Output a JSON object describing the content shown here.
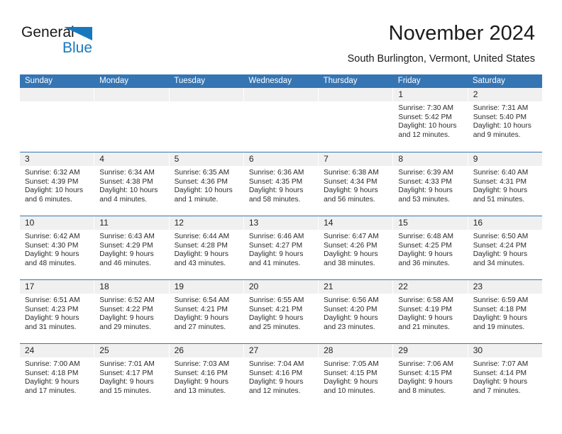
{
  "brand": {
    "name_part1": "General",
    "name_part2": "Blue",
    "accent_color": "#1878be",
    "logo_icon": "triangle-flag-icon"
  },
  "header": {
    "title": "November 2024",
    "subtitle": "South Burlington, Vermont, United States"
  },
  "colors": {
    "header_blue": "#3575b4",
    "day_band_gray": "#f0f0f0",
    "text": "#2b2b2b"
  },
  "weekdays": [
    "Sunday",
    "Monday",
    "Tuesday",
    "Wednesday",
    "Thursday",
    "Friday",
    "Saturday"
  ],
  "weeks": [
    [
      {
        "day": "",
        "lines": []
      },
      {
        "day": "",
        "lines": []
      },
      {
        "day": "",
        "lines": []
      },
      {
        "day": "",
        "lines": []
      },
      {
        "day": "",
        "lines": []
      },
      {
        "day": "1",
        "lines": [
          "Sunrise: 7:30 AM",
          "Sunset: 5:42 PM",
          "Daylight: 10 hours",
          "and 12 minutes."
        ]
      },
      {
        "day": "2",
        "lines": [
          "Sunrise: 7:31 AM",
          "Sunset: 5:40 PM",
          "Daylight: 10 hours",
          "and 9 minutes."
        ]
      }
    ],
    [
      {
        "day": "3",
        "lines": [
          "Sunrise: 6:32 AM",
          "Sunset: 4:39 PM",
          "Daylight: 10 hours",
          "and 6 minutes."
        ]
      },
      {
        "day": "4",
        "lines": [
          "Sunrise: 6:34 AM",
          "Sunset: 4:38 PM",
          "Daylight: 10 hours",
          "and 4 minutes."
        ]
      },
      {
        "day": "5",
        "lines": [
          "Sunrise: 6:35 AM",
          "Sunset: 4:36 PM",
          "Daylight: 10 hours",
          "and 1 minute."
        ]
      },
      {
        "day": "6",
        "lines": [
          "Sunrise: 6:36 AM",
          "Sunset: 4:35 PM",
          "Daylight: 9 hours",
          "and 58 minutes."
        ]
      },
      {
        "day": "7",
        "lines": [
          "Sunrise: 6:38 AM",
          "Sunset: 4:34 PM",
          "Daylight: 9 hours",
          "and 56 minutes."
        ]
      },
      {
        "day": "8",
        "lines": [
          "Sunrise: 6:39 AM",
          "Sunset: 4:33 PM",
          "Daylight: 9 hours",
          "and 53 minutes."
        ]
      },
      {
        "day": "9",
        "lines": [
          "Sunrise: 6:40 AM",
          "Sunset: 4:31 PM",
          "Daylight: 9 hours",
          "and 51 minutes."
        ]
      }
    ],
    [
      {
        "day": "10",
        "lines": [
          "Sunrise: 6:42 AM",
          "Sunset: 4:30 PM",
          "Daylight: 9 hours",
          "and 48 minutes."
        ]
      },
      {
        "day": "11",
        "lines": [
          "Sunrise: 6:43 AM",
          "Sunset: 4:29 PM",
          "Daylight: 9 hours",
          "and 46 minutes."
        ]
      },
      {
        "day": "12",
        "lines": [
          "Sunrise: 6:44 AM",
          "Sunset: 4:28 PM",
          "Daylight: 9 hours",
          "and 43 minutes."
        ]
      },
      {
        "day": "13",
        "lines": [
          "Sunrise: 6:46 AM",
          "Sunset: 4:27 PM",
          "Daylight: 9 hours",
          "and 41 minutes."
        ]
      },
      {
        "day": "14",
        "lines": [
          "Sunrise: 6:47 AM",
          "Sunset: 4:26 PM",
          "Daylight: 9 hours",
          "and 38 minutes."
        ]
      },
      {
        "day": "15",
        "lines": [
          "Sunrise: 6:48 AM",
          "Sunset: 4:25 PM",
          "Daylight: 9 hours",
          "and 36 minutes."
        ]
      },
      {
        "day": "16",
        "lines": [
          "Sunrise: 6:50 AM",
          "Sunset: 4:24 PM",
          "Daylight: 9 hours",
          "and 34 minutes."
        ]
      }
    ],
    [
      {
        "day": "17",
        "lines": [
          "Sunrise: 6:51 AM",
          "Sunset: 4:23 PM",
          "Daylight: 9 hours",
          "and 31 minutes."
        ]
      },
      {
        "day": "18",
        "lines": [
          "Sunrise: 6:52 AM",
          "Sunset: 4:22 PM",
          "Daylight: 9 hours",
          "and 29 minutes."
        ]
      },
      {
        "day": "19",
        "lines": [
          "Sunrise: 6:54 AM",
          "Sunset: 4:21 PM",
          "Daylight: 9 hours",
          "and 27 minutes."
        ]
      },
      {
        "day": "20",
        "lines": [
          "Sunrise: 6:55 AM",
          "Sunset: 4:21 PM",
          "Daylight: 9 hours",
          "and 25 minutes."
        ]
      },
      {
        "day": "21",
        "lines": [
          "Sunrise: 6:56 AM",
          "Sunset: 4:20 PM",
          "Daylight: 9 hours",
          "and 23 minutes."
        ]
      },
      {
        "day": "22",
        "lines": [
          "Sunrise: 6:58 AM",
          "Sunset: 4:19 PM",
          "Daylight: 9 hours",
          "and 21 minutes."
        ]
      },
      {
        "day": "23",
        "lines": [
          "Sunrise: 6:59 AM",
          "Sunset: 4:18 PM",
          "Daylight: 9 hours",
          "and 19 minutes."
        ]
      }
    ],
    [
      {
        "day": "24",
        "lines": [
          "Sunrise: 7:00 AM",
          "Sunset: 4:18 PM",
          "Daylight: 9 hours",
          "and 17 minutes."
        ]
      },
      {
        "day": "25",
        "lines": [
          "Sunrise: 7:01 AM",
          "Sunset: 4:17 PM",
          "Daylight: 9 hours",
          "and 15 minutes."
        ]
      },
      {
        "day": "26",
        "lines": [
          "Sunrise: 7:03 AM",
          "Sunset: 4:16 PM",
          "Daylight: 9 hours",
          "and 13 minutes."
        ]
      },
      {
        "day": "27",
        "lines": [
          "Sunrise: 7:04 AM",
          "Sunset: 4:16 PM",
          "Daylight: 9 hours",
          "and 12 minutes."
        ]
      },
      {
        "day": "28",
        "lines": [
          "Sunrise: 7:05 AM",
          "Sunset: 4:15 PM",
          "Daylight: 9 hours",
          "and 10 minutes."
        ]
      },
      {
        "day": "29",
        "lines": [
          "Sunrise: 7:06 AM",
          "Sunset: 4:15 PM",
          "Daylight: 9 hours",
          "and 8 minutes."
        ]
      },
      {
        "day": "30",
        "lines": [
          "Sunrise: 7:07 AM",
          "Sunset: 4:14 PM",
          "Daylight: 9 hours",
          "and 7 minutes."
        ]
      }
    ]
  ]
}
